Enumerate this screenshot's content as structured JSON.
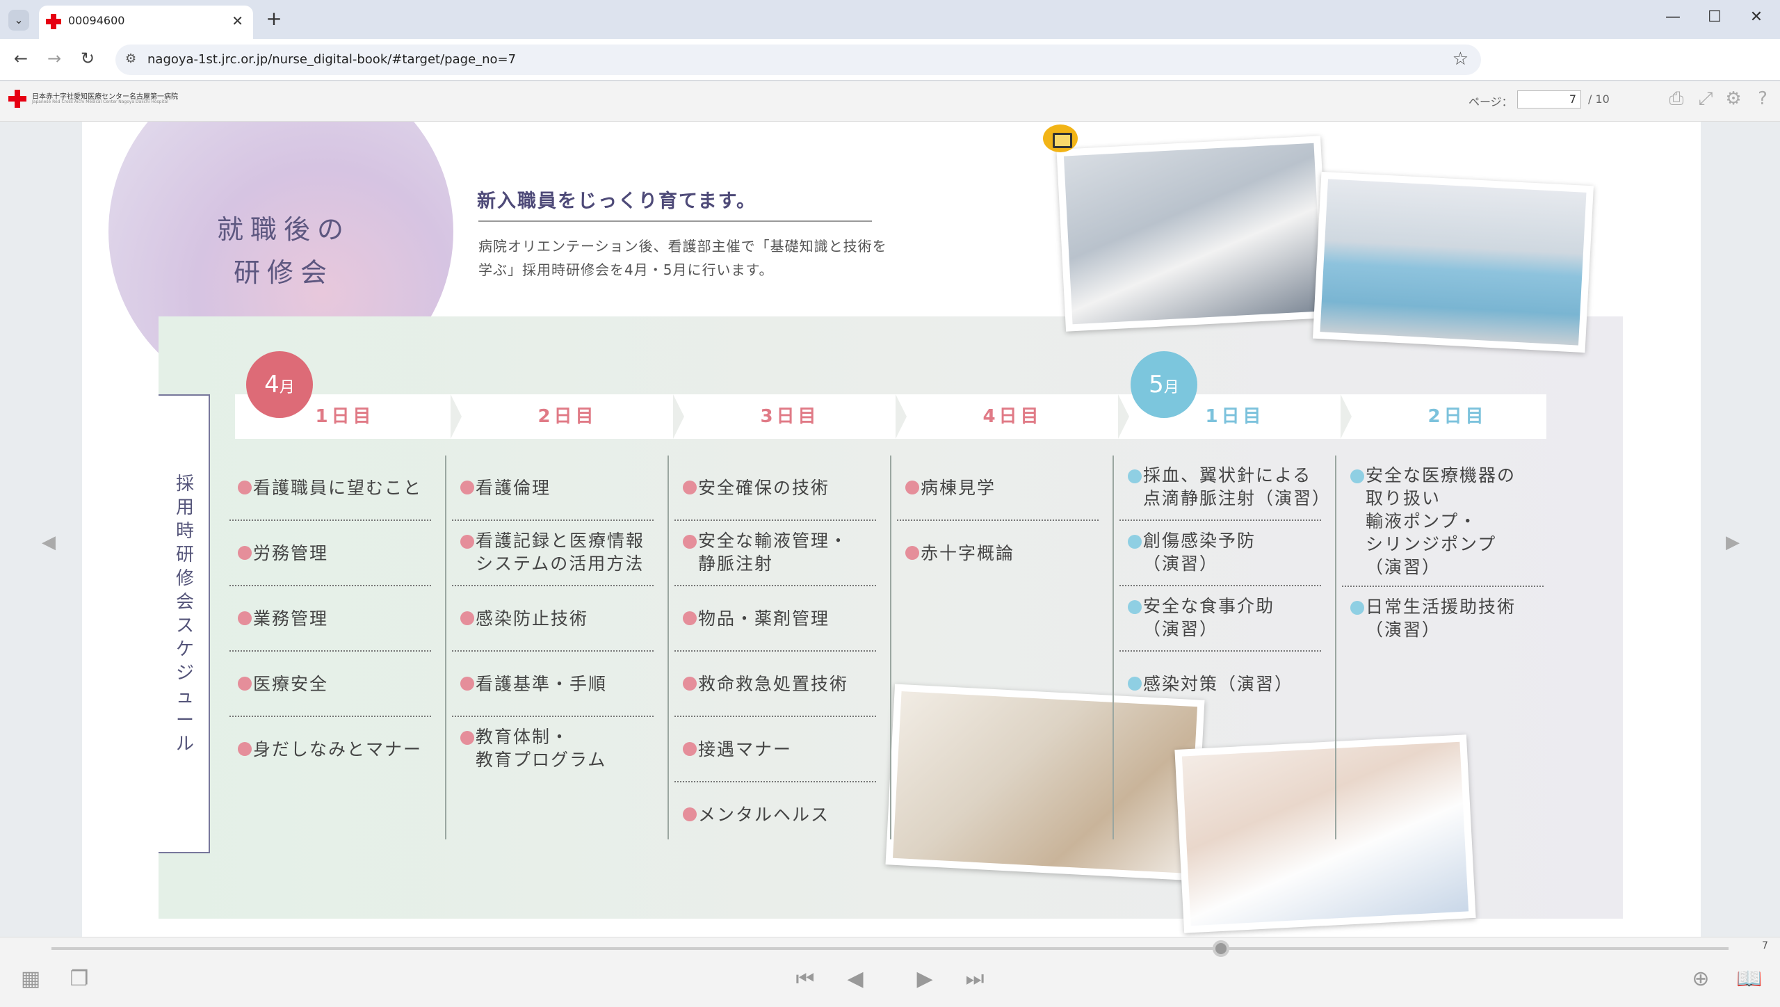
{
  "browser": {
    "tab_title": "00094600",
    "tab_close": "✕",
    "new_tab": "+",
    "url": "nagoya-1st.jrc.or.jp/nurse_digital-book/#target/page_no=7",
    "window_controls": {
      "minimize": "—",
      "maximize": "☐",
      "close": "✕"
    }
  },
  "viewer": {
    "logo_name": "日本赤十字社愛知医療センター名古屋第一病院",
    "logo_subname": "Japanese Red Cross Aichi Medical Center Nagoya Daiichi Hospital",
    "page_label": "ページ：",
    "page_value": "7",
    "page_total": "/ 10",
    "slider_page": "7"
  },
  "content": {
    "heading": "就職後の研修会",
    "subtitle": "新入職員をじっくり育てます。",
    "description": "病院オリエンテーション後、看護部主催で「基礎知識と技術を学ぶ」採用時研修会を4月・5月に行います。",
    "vertical_label": "採用時研修会スケジュール",
    "months": [
      {
        "num": "4",
        "unit": "月",
        "color": "#dd6b77"
      },
      {
        "num": "5",
        "unit": "月",
        "color": "#7cc6dd"
      }
    ],
    "days": [
      {
        "label": "1日目",
        "month": "apr"
      },
      {
        "label": "2日目",
        "month": "apr"
      },
      {
        "label": "3日目",
        "month": "apr"
      },
      {
        "label": "4日目",
        "month": "apr"
      },
      {
        "label": "1日目",
        "month": "may"
      },
      {
        "label": "2日目",
        "month": "may"
      }
    ],
    "columns": [
      {
        "items": [
          "看護職員に望むこと",
          "労務管理",
          "業務管理",
          "医療安全",
          "身だしなみとマナー"
        ]
      },
      {
        "items": [
          "看護倫理",
          "看護記録と医療情報\nシステムの活用方法",
          "感染防止技術",
          "看護基準・手順",
          "教育体制・\n教育プログラム"
        ]
      },
      {
        "items": [
          "安全確保の技術",
          "安全な輸液管理・\n静脈注射",
          "物品・薬剤管理",
          "救命救急処置技術",
          "接遇マナー",
          "メンタルヘルス"
        ]
      },
      {
        "items": [
          "病棟見学",
          "赤十字概論"
        ]
      },
      {
        "items": [
          "採血、翼状針による\n点滴静脈注射（演習）",
          "創傷感染予防\n（演習）",
          "安全な食事介助\n（演習）",
          "感染対策（演習）"
        ]
      },
      {
        "items": [
          "安全な医療機器の\n取り扱い\n輸液ポンプ・\nシリンジポンプ\n（演習）",
          "日常生活援助技術\n（演習）"
        ]
      }
    ]
  },
  "icons": {
    "tab_menu": "⌄",
    "back": "←",
    "forward": "→",
    "reload": "↻",
    "site_info": "⚙",
    "bookmark": "☆",
    "print": "⎙",
    "fullscreen": "⤢",
    "settings": "⚙",
    "help": "?",
    "prev_page_side": "◀",
    "next_page_side": "▶",
    "thumbnails": "▦",
    "pages": "❐",
    "first": "⏮",
    "prev": "◀",
    "next": "▶",
    "last": "⏭",
    "zoom": "⊕",
    "book": "📖"
  }
}
